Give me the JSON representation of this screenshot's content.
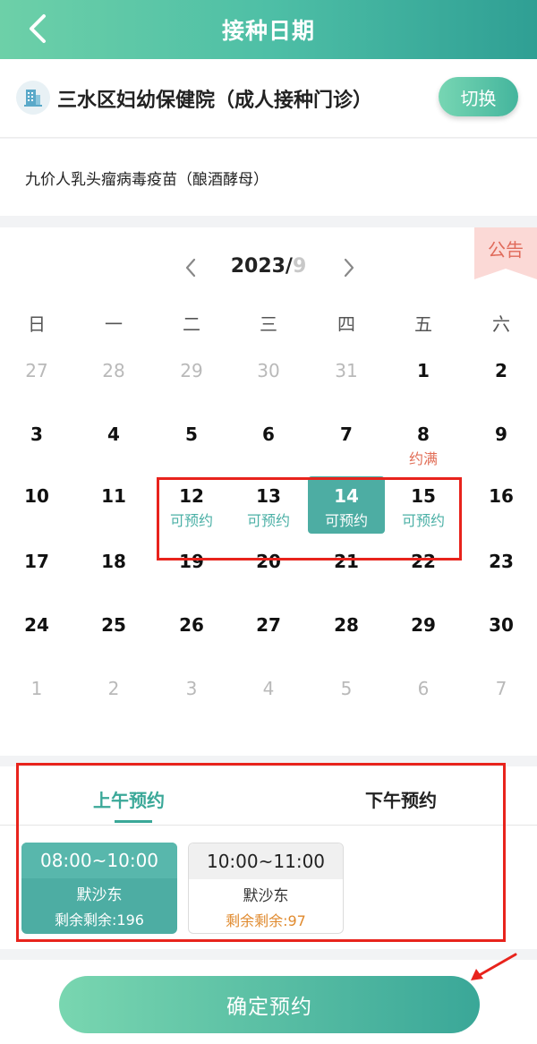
{
  "header": {
    "title": "接种日期"
  },
  "hospital": {
    "name": "三水区妇幼保健院（成人接种门诊）",
    "switch_label": "切换"
  },
  "vaccine": {
    "name": "九价人乳头瘤病毒疫苗（酿酒酵母）"
  },
  "calendar": {
    "notice_label": "公告",
    "year_label": "2023/",
    "month_label": "9",
    "weekdays": [
      "日",
      "一",
      "二",
      "三",
      "四",
      "五",
      "六"
    ],
    "weeks": [
      [
        {
          "d": "27",
          "o": true
        },
        {
          "d": "28",
          "o": true
        },
        {
          "d": "29",
          "o": true
        },
        {
          "d": "30",
          "o": true
        },
        {
          "d": "31",
          "o": true
        },
        {
          "d": "1"
        },
        {
          "d": "2"
        }
      ],
      [
        {
          "d": "3"
        },
        {
          "d": "4"
        },
        {
          "d": "5"
        },
        {
          "d": "6"
        },
        {
          "d": "7"
        },
        {
          "d": "8",
          "s": "约满",
          "full": true
        },
        {
          "d": "9"
        }
      ],
      [
        {
          "d": "10"
        },
        {
          "d": "11"
        },
        {
          "d": "12",
          "s": "可预约"
        },
        {
          "d": "13",
          "s": "可预约"
        },
        {
          "d": "14",
          "s": "可预约",
          "sel": true
        },
        {
          "d": "15",
          "s": "可预约"
        },
        {
          "d": "16"
        }
      ],
      [
        {
          "d": "17"
        },
        {
          "d": "18"
        },
        {
          "d": "19"
        },
        {
          "d": "20"
        },
        {
          "d": "21"
        },
        {
          "d": "22"
        },
        {
          "d": "23"
        }
      ],
      [
        {
          "d": "24"
        },
        {
          "d": "25"
        },
        {
          "d": "26"
        },
        {
          "d": "27"
        },
        {
          "d": "28"
        },
        {
          "d": "29"
        },
        {
          "d": "30"
        }
      ],
      [
        {
          "d": "1",
          "o": true
        },
        {
          "d": "2",
          "o": true
        },
        {
          "d": "3",
          "o": true
        },
        {
          "d": "4",
          "o": true
        },
        {
          "d": "5",
          "o": true
        },
        {
          "d": "6",
          "o": true
        },
        {
          "d": "7",
          "o": true
        }
      ]
    ]
  },
  "tabs": {
    "morning": "上午预约",
    "afternoon": "下午预约"
  },
  "slots": [
    {
      "time": "08:00~10:00",
      "location": "默沙东",
      "remaining": "剩余剩余:196"
    },
    {
      "time": "10:00~11:00",
      "location": "默沙东",
      "remaining": "剩余剩余:97"
    }
  ],
  "footer": {
    "confirm_label": "确定预约"
  },
  "colors": {
    "accent": "#4dada3",
    "annotation_red": "#e8231c",
    "full_status": "#e16d56"
  }
}
